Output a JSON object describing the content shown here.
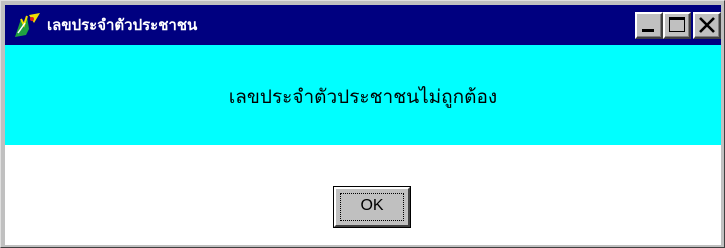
{
  "window": {
    "title": "เลขประจำตัวประชาชน",
    "icon": "app-icon",
    "controls": {
      "minimize": "minimize-icon",
      "maximize": "maximize-icon",
      "close": "close-icon"
    }
  },
  "banner": {
    "message": "เลขประจำตัวประชาชนไม่ถูกต้อง",
    "background": "#00ffff"
  },
  "actions": {
    "ok_label": "OK"
  },
  "colors": {
    "titlebar": "#000080",
    "face": "#c0c0c0",
    "content": "#ffffff"
  }
}
